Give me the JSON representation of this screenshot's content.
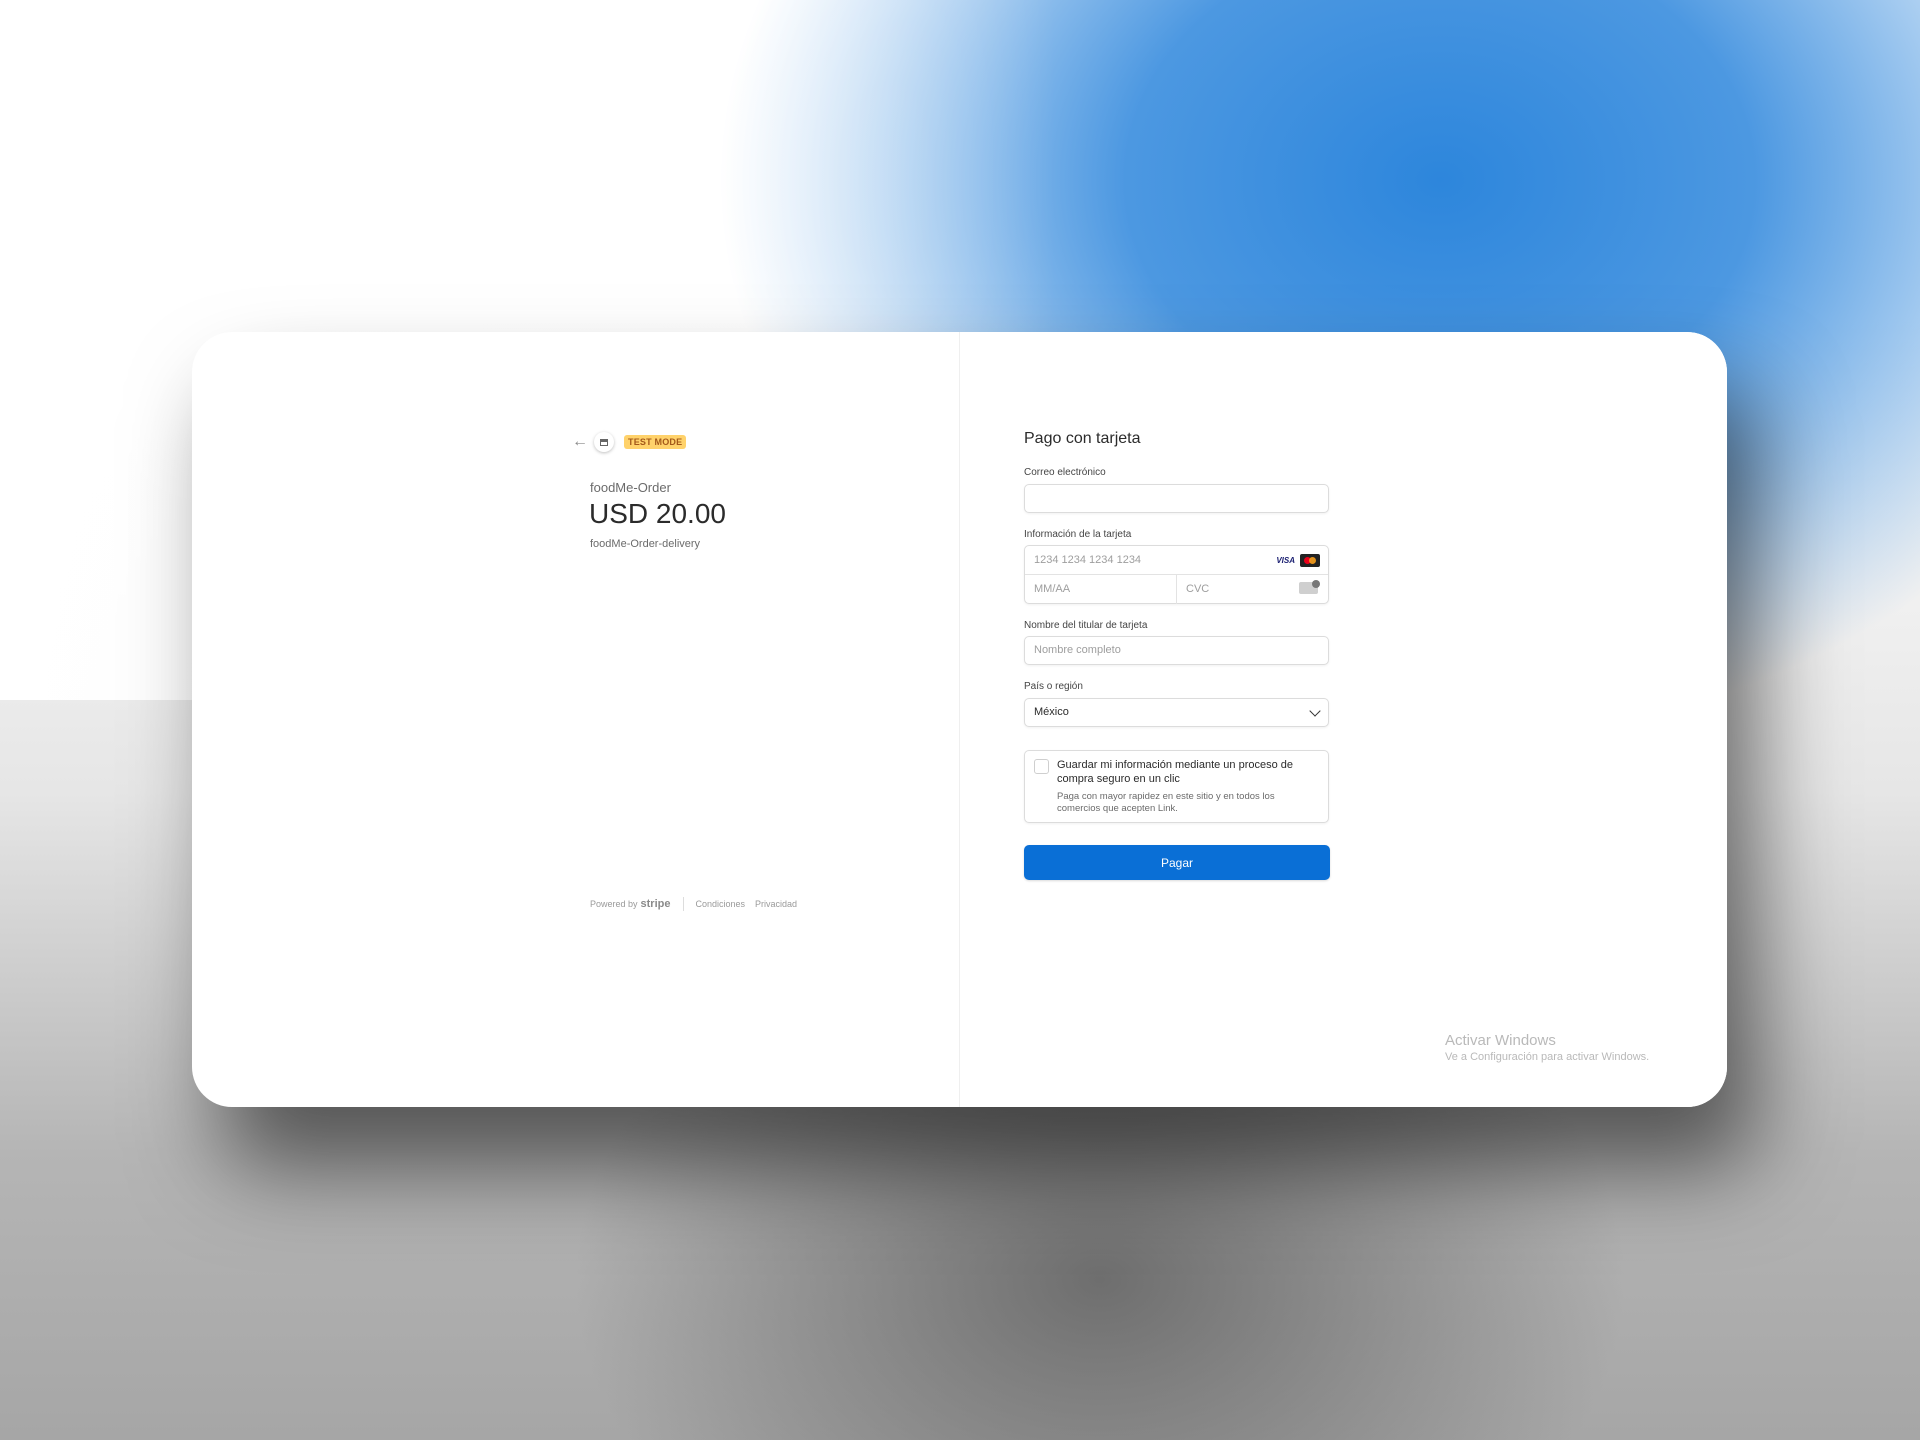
{
  "checkout": {
    "test_mode_badge": "TEST MODE",
    "product_name": "foodMe-Order",
    "price": "USD 20.00",
    "product_description": "foodMe-Order-delivery",
    "footer": {
      "powered_by": "Powered by",
      "brand": "stripe",
      "terms": "Condiciones",
      "privacy": "Privacidad"
    }
  },
  "form": {
    "title": "Pago con tarjeta",
    "email_label": "Correo electrónico",
    "email_value": "",
    "card_label": "Información de la tarjeta",
    "card_number_placeholder": "1234 1234 1234 1234",
    "visa_label": "VISA",
    "expiry_placeholder": "MM/AA",
    "cvc_placeholder": "CVC",
    "name_label": "Nombre del titular de tarjeta",
    "name_placeholder": "Nombre completo",
    "country_label": "País o región",
    "country_value": "México",
    "save_title": "Guardar mi información mediante un proceso de compra seguro en un clic",
    "save_subtitle": "Paga con mayor rapidez en este sitio y en todos los comercios que acepten Link.",
    "pay_button": "Pagar"
  },
  "watermark": {
    "line1": "Activar Windows",
    "line2": "Ve a Configuración para activar Windows."
  },
  "colors": {
    "pay_button": "#0a6fd6",
    "test_badge_bg": "#ffd26b",
    "test_badge_text": "#a4591a"
  }
}
